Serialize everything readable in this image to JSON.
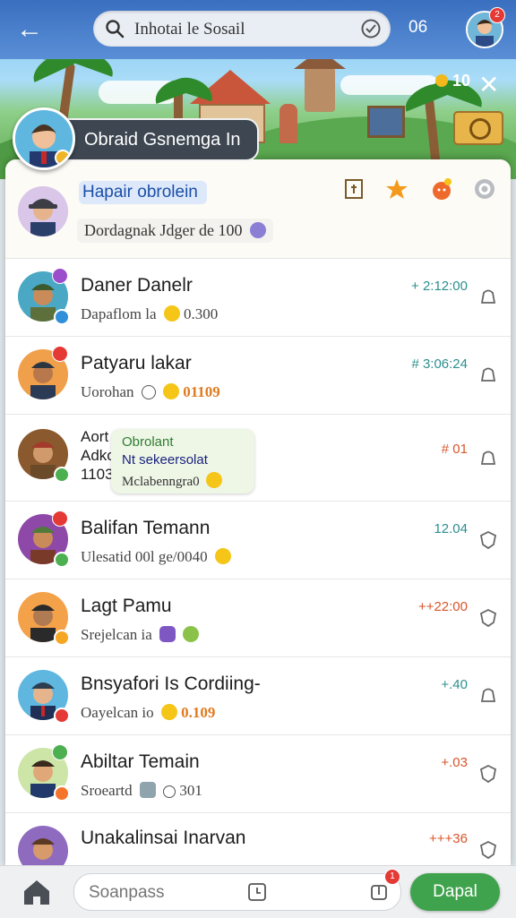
{
  "topbar": {
    "search_value": "Inhotai le Sosail",
    "counter": "06",
    "avatar_badge": "2"
  },
  "profile": {
    "name": "Obraid Gsnemga In"
  },
  "scene": {
    "coins_label": "10"
  },
  "pinned": {
    "title": "Hapair obrolein",
    "subtitle": "Dordagnak Jdger de 100"
  },
  "chats": [
    {
      "name": "Daner Danelr",
      "preview": "Dapaflom la",
      "preview_tail": "0.300",
      "time": "+ 2:12:00",
      "time_color": "#2d8f8f"
    },
    {
      "name": "Patyaru lakar",
      "preview": "Uorohan",
      "preview_tail": "01109",
      "time": "# 3:06:24",
      "time_color": "#2d8f8f"
    },
    {
      "name_lines": [
        "Aort",
        "Adko",
        "1103"
      ],
      "time": "# 01",
      "time_color": "#d9552b",
      "bubble": {
        "line1": "Obrolant",
        "line2": "Nt sekeersolat",
        "line3": "Mclabenngra0"
      }
    },
    {
      "name": "Balifan Temann",
      "preview": "Ulesatid",
      "preview_tail": "00l ge/0040",
      "time": "12.04",
      "time_color": "#2d8f8f"
    },
    {
      "name": "Lagt Pamu",
      "preview": "Srejelcan ia",
      "time": "++22:00",
      "time_color": "#d9552b"
    },
    {
      "name": "Bnsyafori Is Cordiing-",
      "preview": "Oayelcan io",
      "preview_tail": "0.109",
      "time": "+.40",
      "time_color": "#2d8f8f"
    },
    {
      "name": "Abiltar Temain",
      "preview": "Sroeartd",
      "preview_tail": "301",
      "time": "+.03",
      "time_color": "#d9552b"
    },
    {
      "name": "Unakalinsai Inarvan",
      "time": "+++36",
      "time_color": "#d9552b"
    }
  ],
  "bottombar": {
    "input_placeholder": "Soanpass",
    "send_label": "Dapal",
    "badge": "1"
  },
  "icons": [
    "back-arrow-icon",
    "search-icon",
    "clock-icon",
    "close-icon",
    "coin-icon",
    "board-sign-icon",
    "bookmark-icon",
    "star-icon",
    "tomato-icon",
    "settings-icon",
    "bell-icon",
    "shield-icon",
    "home-icon",
    "timer-icon",
    "share-icon"
  ],
  "colors": {
    "topbar": "#3a6fc0",
    "send": "#3fa34d",
    "accent_orange": "#e07a1d",
    "time_teal": "#2d8f8f",
    "time_red": "#d9552b"
  }
}
